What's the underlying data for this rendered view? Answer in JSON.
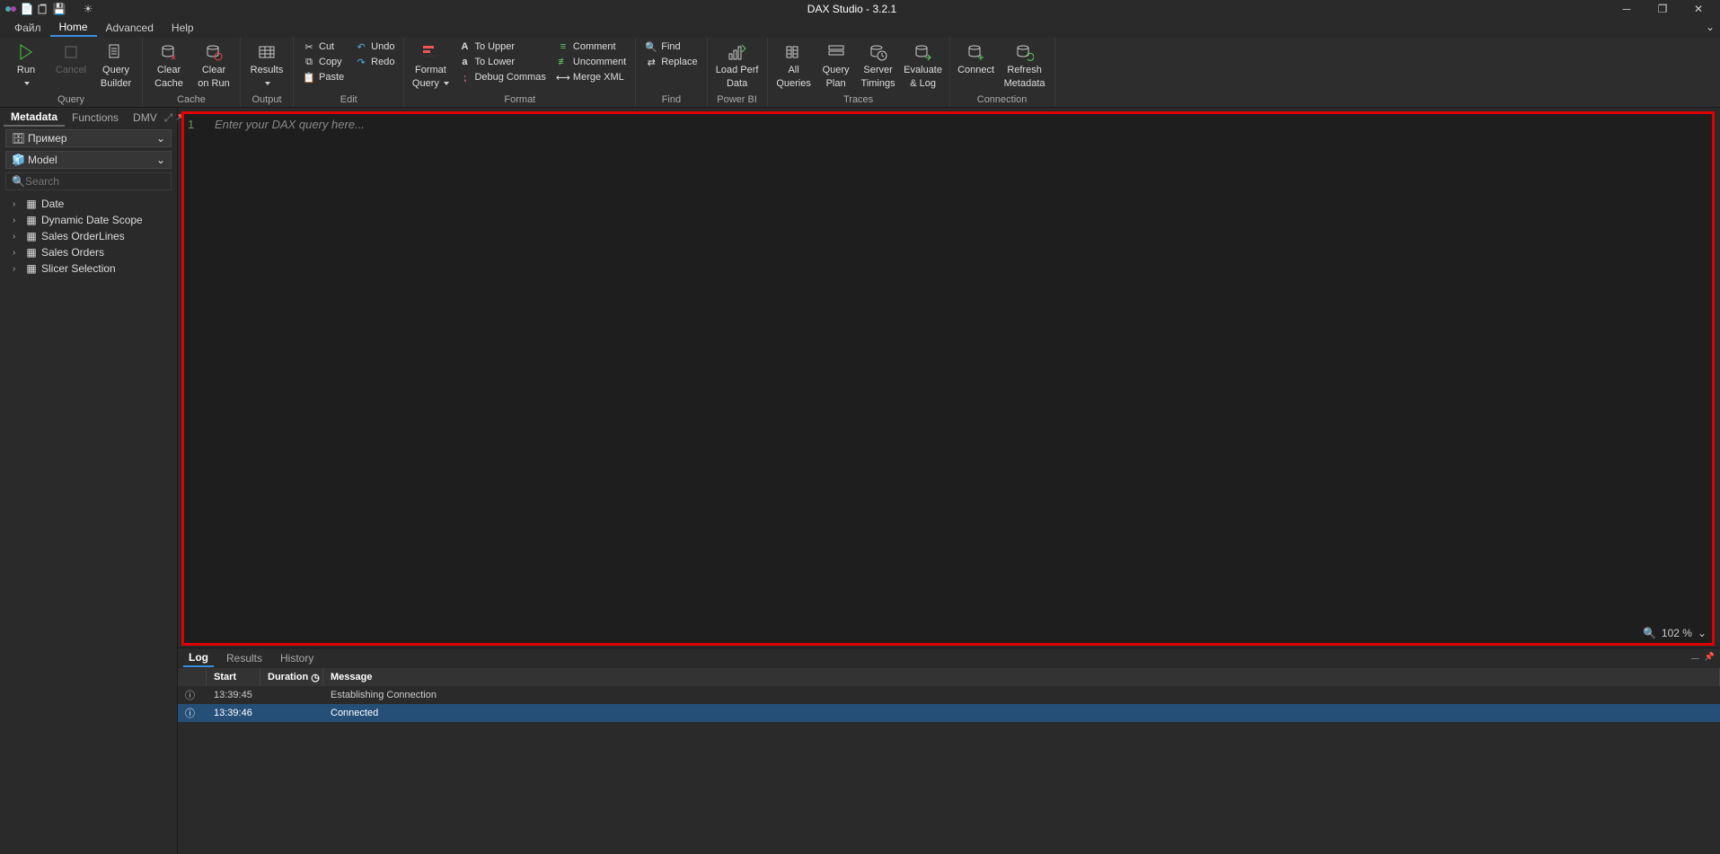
{
  "titlebar": {
    "title": "DAX Studio - 3.2.1"
  },
  "menubar": {
    "file": "Файл",
    "home": "Home",
    "advanced": "Advanced",
    "help": "Help"
  },
  "ribbon": {
    "query": {
      "run": "Run",
      "cancel": "Cancel",
      "queryBuilder1": "Query",
      "queryBuilder2": "Builder",
      "label": "Query"
    },
    "cache": {
      "clearCache1": "Clear",
      "clearCache2": "Cache",
      "clearOnRun1": "Clear",
      "clearOnRun2": "on Run",
      "label": "Cache"
    },
    "output": {
      "results": "Results",
      "label": "Output"
    },
    "edit": {
      "cut": "Cut",
      "copy": "Copy",
      "paste": "Paste",
      "undo": "Undo",
      "redo": "Redo",
      "label": "Edit"
    },
    "format": {
      "formatQuery1": "Format",
      "formatQuery2": "Query",
      "toUpper": "To Upper",
      "toLower": "To Lower",
      "debugCommas": "Debug Commas",
      "comment": "Comment",
      "uncomment": "Uncomment",
      "mergeXml": "Merge XML",
      "label": "Format"
    },
    "find": {
      "find": "Find",
      "replace": "Replace",
      "label": "Find"
    },
    "powerbi": {
      "loadPerf1": "Load Perf",
      "loadPerf2": "Data",
      "label": "Power BI"
    },
    "traces": {
      "allQueries1": "All",
      "allQueries2": "Queries",
      "queryPlan1": "Query",
      "queryPlan2": "Plan",
      "serverTimings1": "Server",
      "serverTimings2": "Timings",
      "evalLog1": "Evaluate",
      "evalLog2": "& Log",
      "label": "Traces"
    },
    "connection": {
      "connect": "Connect",
      "refresh1": "Refresh",
      "refresh2": "Metadata",
      "label": "Connection"
    }
  },
  "sidebar": {
    "tabs": {
      "metadata": "Metadata",
      "functions": "Functions",
      "dmv": "DMV"
    },
    "dbSelect": "Пример",
    "modelSelect": "Model",
    "searchPlaceholder": "Search",
    "tables": [
      "Date",
      "Dynamic Date Scope",
      "Sales OrderLines",
      "Sales Orders",
      "Slicer Selection"
    ]
  },
  "editor": {
    "lineNumber": "1",
    "placeholder": "Enter your DAX query here...",
    "zoom": "102 %"
  },
  "bottom": {
    "tabs": {
      "log": "Log",
      "results": "Results",
      "history": "History"
    },
    "headers": {
      "start": "Start",
      "duration": "Duration",
      "message": "Message"
    },
    "rows": [
      {
        "time": "13:39:45",
        "msg": "Establishing Connection"
      },
      {
        "time": "13:39:46",
        "msg": "Connected"
      }
    ]
  }
}
